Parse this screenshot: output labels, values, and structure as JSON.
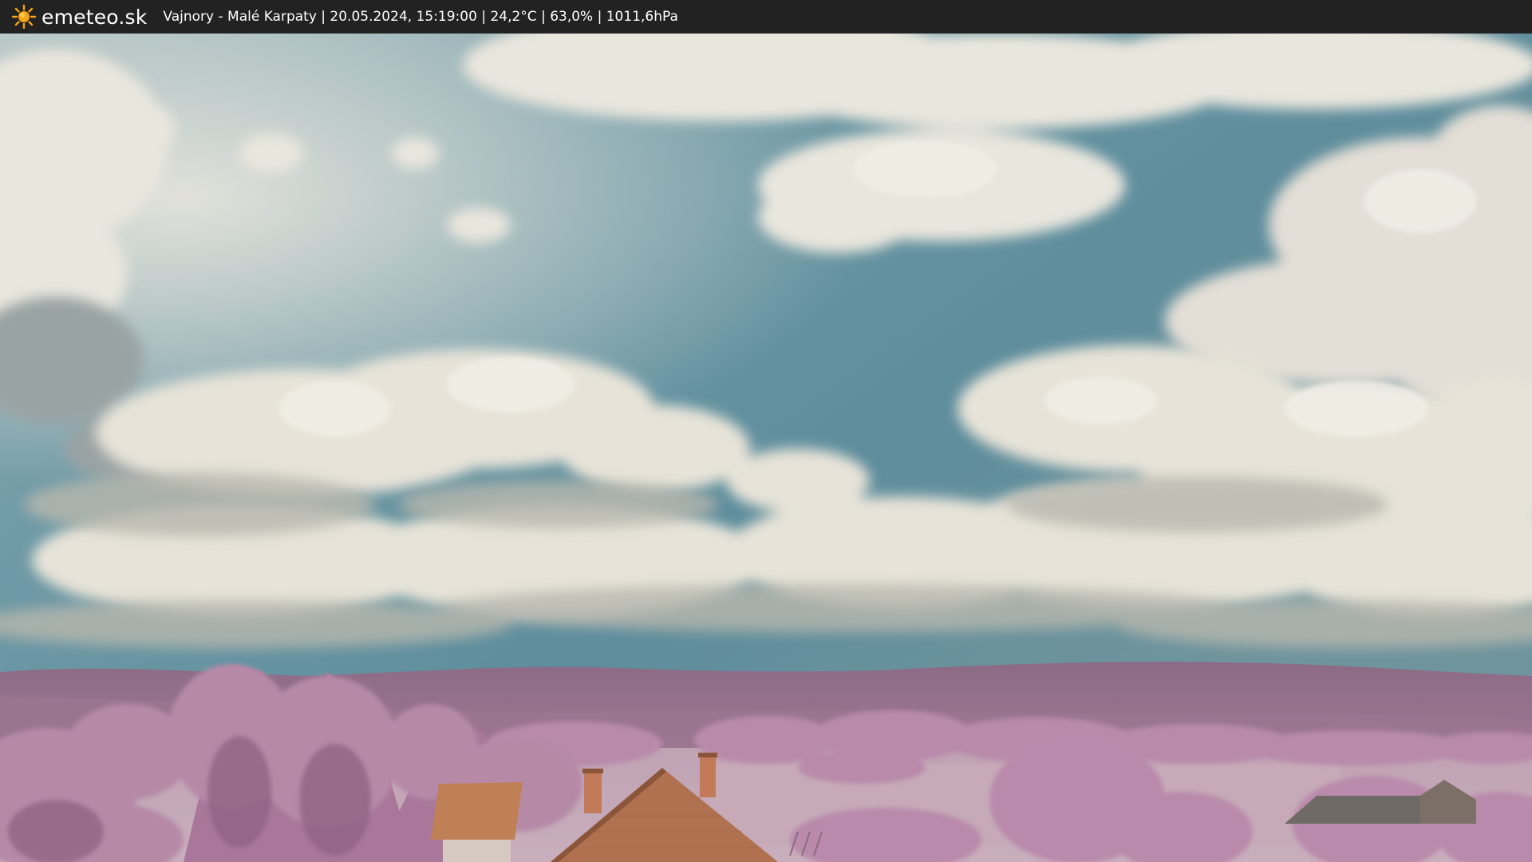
{
  "header": {
    "brand": "emeteo.sk",
    "info": "Vajnory - Malé Karpaty | 20.05.2024, 15:19:00 | 24,2°C | 63,0% | 1011,6hPa"
  },
  "icons": {
    "brand_icon": "sun-icon"
  },
  "colors": {
    "bar_background": "#222222",
    "bar_text": "#ffffff",
    "sun": "#f4a41a"
  }
}
